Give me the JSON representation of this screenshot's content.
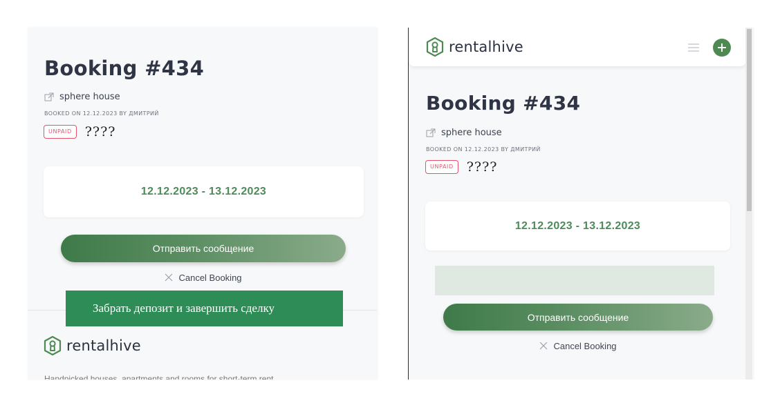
{
  "left": {
    "booking_title": "Booking #434",
    "property_name": "sphere house",
    "booked_on": "BOOKED ON 12.12.2023 BY ДМИТРИЙ",
    "status_badge": "UNPAID",
    "status_extra": "????",
    "date_range": "12.12.2023 - 13.12.2023",
    "send_message_label": "Отправить сообщение",
    "cancel_label": "Cancel Booking",
    "deposit_label": "Забрать депозит и завершить сделку",
    "footer_logo": "rentalhive",
    "footer_text": "Handpicked houses, apartments and rooms for short-term rent"
  },
  "right": {
    "logo": "rentalhive",
    "booking_title": "Booking #434",
    "property_name": "sphere house",
    "booked_on": "BOOKED ON 12.12.2023 BY ДМИТРИЙ",
    "status_badge": "UNPAID",
    "status_extra": "????",
    "date_range": "12.12.2023 - 13.12.2023",
    "send_message_label": "Отправить сообщение",
    "cancel_label": "Cancel Booking"
  },
  "icons": {
    "external_link": "external-link-icon",
    "close": "close-icon",
    "menu": "hamburger-menu-icon",
    "add": "plus-icon",
    "logo": "rentalhive-keyhole-logo"
  },
  "colors": {
    "accent_green": "#4e8a5a",
    "deposit_green": "#2e8d57",
    "unpaid_red": "#e5526c",
    "button_gradient_start": "#3f7a4a",
    "button_gradient_end": "#8aab8a"
  }
}
